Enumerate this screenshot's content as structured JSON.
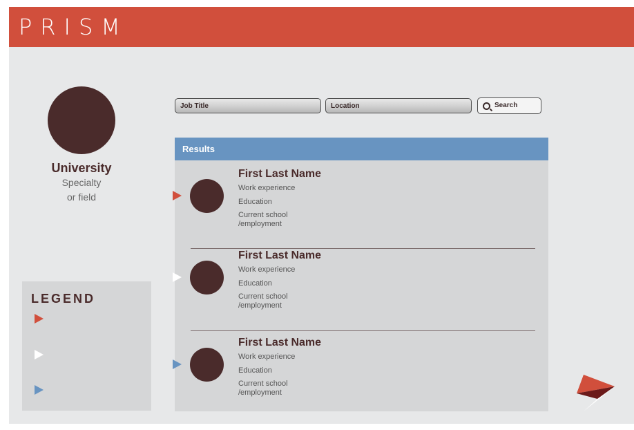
{
  "app": {
    "brand": "PRISM"
  },
  "profile": {
    "name": "University",
    "line1": "Specialty",
    "line2": "or field"
  },
  "legend": {
    "title": "LEGEND",
    "colors": [
      "#d14f3c",
      "#ffffff",
      "#6894c1"
    ]
  },
  "search": {
    "job_placeholder": "Job Title",
    "location_placeholder": "Location",
    "button_label": "Search"
  },
  "results": {
    "title": "Results",
    "items": [
      {
        "name": "First Last Name",
        "work": "Work experience",
        "education": "Education",
        "current1": "Current school",
        "current2": "/employment",
        "marker_color": "#d14f3c"
      },
      {
        "name": "First Last Name",
        "work": "Work experience",
        "education": "Education",
        "current1": "Current school",
        "current2": "/employment",
        "marker_color": "#ffffff"
      },
      {
        "name": "First Last Name",
        "work": "Work experience",
        "education": "Education",
        "current1": "Current school",
        "current2": "/employment",
        "marker_color": "#6894c1"
      }
    ]
  },
  "colors": {
    "header": "#d14f3c",
    "accent_blue": "#6894c1",
    "avatar": "#4a2b2b"
  }
}
